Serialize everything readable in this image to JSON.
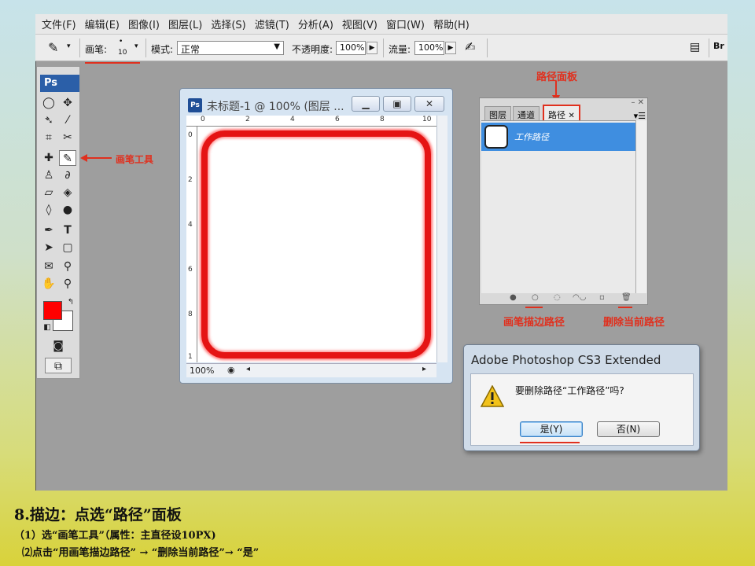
{
  "menu": [
    "文件(F)",
    "编辑(E)",
    "图像(I)",
    "图层(L)",
    "选择(S)",
    "滤镜(T)",
    "分析(A)",
    "视图(V)",
    "窗口(W)",
    "帮助(H)"
  ],
  "options": {
    "brush_label": "画笔:",
    "brush_size": "10",
    "mode_label": "模式:",
    "mode_value": "正常",
    "opacity_label": "不透明度:",
    "opacity_value": "100%",
    "flow_label": "流量:",
    "flow_value": "100%"
  },
  "toolbox": {
    "logo": "Ps"
  },
  "document": {
    "title": "未标题-1 @ 100% (图层 ...",
    "zoom": "100%",
    "ruler_h": [
      "0",
      "2",
      "4",
      "6",
      "8",
      "10"
    ],
    "ruler_v": [
      "0",
      "2",
      "4",
      "6",
      "8",
      "1"
    ]
  },
  "paths_panel": {
    "tabs": [
      "图层",
      "通道",
      "路径"
    ],
    "path_name": "工作路径"
  },
  "annotations": {
    "paths_panel": "路径面板",
    "brush_tool": "画笔工具",
    "stroke_path": "画笔描边路径",
    "delete_path": "删除当前路径"
  },
  "dialog": {
    "title": "Adobe Photoshop CS3 Extended",
    "message": "要删除路径“工作路径”吗?",
    "yes": "是(Y)",
    "no": "否(N)"
  },
  "caption": {
    "heading": "8.描边：点选“路径”面板",
    "step1": "（1）选“画笔工具”（属性：主直径设10PX)",
    "step2": "⑵点击“用画笔描边路径” → “删除当前路径”→ “是”"
  },
  "colors": {
    "annotation": "#e0301e",
    "foreground": "#ff0000",
    "selection": "#3f8ee0"
  }
}
